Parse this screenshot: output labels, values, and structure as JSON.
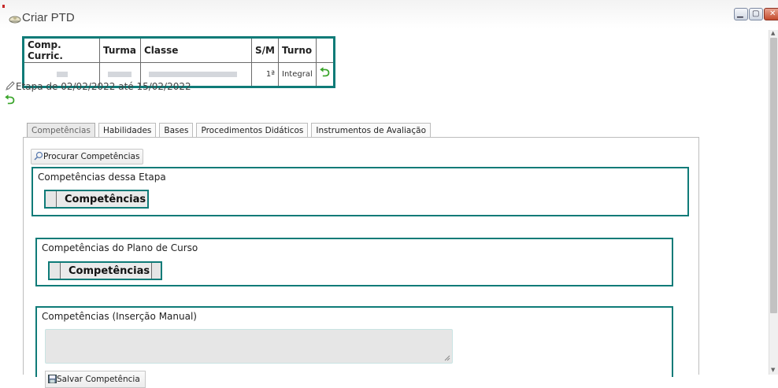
{
  "window": {
    "title": "Criar PTD",
    "controls": [
      "minimize-icon",
      "maximize-icon",
      "close-icon"
    ]
  },
  "info_table": {
    "headers": [
      "Comp. Curric.",
      "Turma",
      "Classe",
      "S/M",
      "Turno",
      ""
    ],
    "row": {
      "sm": "1ª",
      "turno": "Integral"
    }
  },
  "etapa": {
    "text": "Etapa de 02/02/2022 até 15/02/2022"
  },
  "tabs": [
    {
      "label": "Competências",
      "active": true
    },
    {
      "label": "Habilidades",
      "active": false
    },
    {
      "label": "Bases",
      "active": false
    },
    {
      "label": "Procedimentos Didáticos",
      "active": false
    },
    {
      "label": "Instrumentos de Avaliação",
      "active": false
    }
  ],
  "panel": {
    "search_button": "Procurar Competências",
    "section_etapa": {
      "label": "Competências dessa Etapa",
      "header": "Competências"
    },
    "section_plano": {
      "label": "Competências do Plano de Curso",
      "header": "Competências"
    },
    "section_manual": {
      "label": "Competências (Inserção Manual)",
      "input_value": "",
      "save_button": "Salvar Competência"
    }
  },
  "colors": {
    "accent": "#0f7b78",
    "undo": "#3aa52b"
  }
}
